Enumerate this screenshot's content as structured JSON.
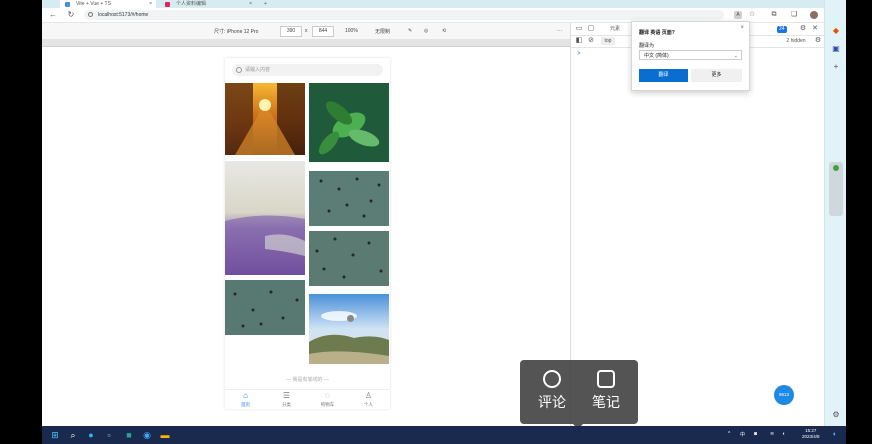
{
  "browser": {
    "tabs": [
      {
        "label": "Vite + Vue + TS"
      },
      {
        "label": "个人资料编辑"
      }
    ],
    "tab_add": "+",
    "tab_close": "×",
    "url": "localhost:5173/#/home",
    "nav": {
      "back": "←",
      "reload": "↻"
    },
    "zoom_badge": "A"
  },
  "devtools_bar": {
    "device_label": "尺寸: iPhone 12 Pro",
    "width": "390",
    "times": "x",
    "height": "844",
    "zoom": "100%",
    "throttle": "无限制",
    "more": "···"
  },
  "phone": {
    "search_placeholder": "请输入内容",
    "end_text": "— 我是有底线的 —",
    "tabs": [
      {
        "label": "首页",
        "icon": "home-icon"
      },
      {
        "label": "分类",
        "icon": "list-icon"
      },
      {
        "label": "购物车",
        "icon": "cart-icon"
      },
      {
        "label": "个人",
        "icon": "user-icon"
      }
    ]
  },
  "devtools_panel": {
    "tab_label": "元素",
    "filter": "top",
    "issues_count": "24",
    "size_readout": "2 hidden",
    "prompt": ">"
  },
  "translate_popup": {
    "title": "翻译 英语 页面?",
    "translate_to_label": "翻译为",
    "target_language": "中文 (简体)",
    "translate_button": "翻译",
    "more_button": "更多",
    "close": "×"
  },
  "fab": {
    "label": "9613"
  },
  "overlay": {
    "comment": "评论",
    "notes": "笔记"
  },
  "taskbar": {
    "ime": "中",
    "time": "15:27",
    "date": "2023/4/8"
  },
  "colors": {
    "accent": "#1677ff",
    "popup_button": "#0a6ed1",
    "taskbar": "#1a2a4f",
    "sidebar": "#e1f3f6"
  }
}
